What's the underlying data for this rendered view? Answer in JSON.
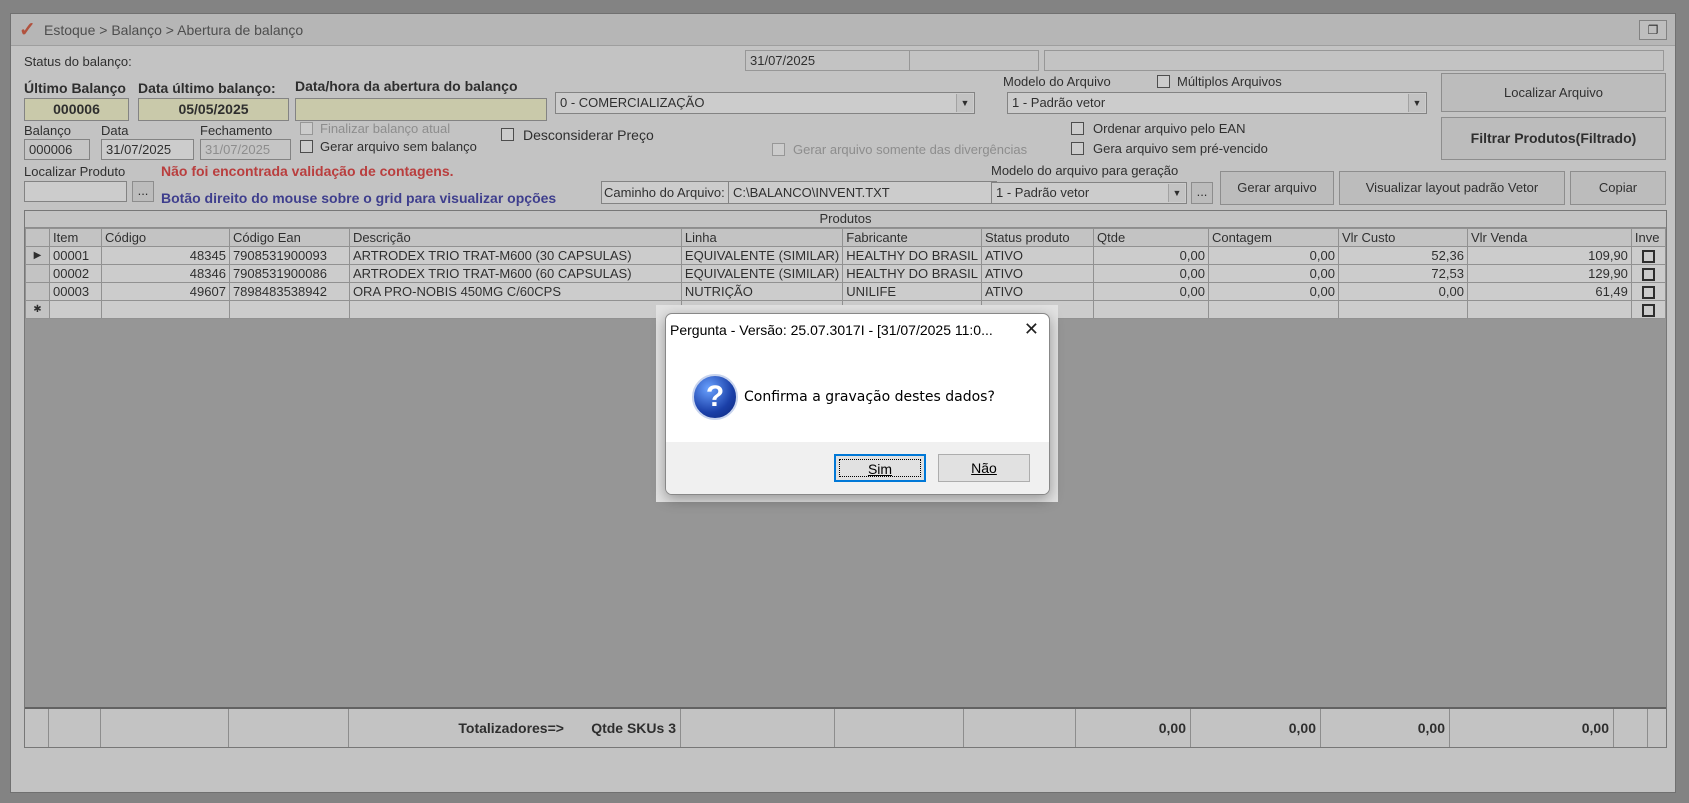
{
  "window": {
    "title": "Estoque > Balanço > Abertura de balanço",
    "logo_glyph": "✓",
    "restore_glyph": "❐"
  },
  "status": {
    "label": "Status do balanço:",
    "date": "31/07/2025"
  },
  "header": {
    "ultimo_balanco_label": "Último Balanço",
    "ultimo_balanco_value": "000006",
    "data_ultimo_label": "Data último balanço:",
    "data_ultimo_value": "05/05/2025",
    "abertura_label": "Data/hora da abertura do balanço",
    "abertura_value": "",
    "comercializacao_value": "0 - COMERCIALIZAÇÃO",
    "modelo_arquivo_label": "Modelo do Arquivo",
    "modelo_arquivo_value": "1 - Padrão vetor",
    "multiplos_label": "Múltiplos Arquivos",
    "localizar_arquivo_btn": "Localizar Arquivo"
  },
  "row2": {
    "balanco_label": "Balanço",
    "balanco_value": "000006",
    "data_label": "Data",
    "data_value": "31/07/2025",
    "fechamento_label": "Fechamento",
    "fechamento_value": "31/07/2025",
    "finalizar_label": "Finalizar balanço atual",
    "gerar_sem_label": "Gerar arquivo sem balanço",
    "desconsiderar_label": "Desconsiderar Preço",
    "gerar_div_label": "Gerar arquivo somente das divergências",
    "ordenar_label": "Ordenar arquivo pelo EAN",
    "gera_prevenc_label": "Gera arquivo sem pré-vencido",
    "filtrar_btn": "Filtrar Produtos(Filtrado)"
  },
  "row3": {
    "localizar_label": "Localizar Produto",
    "localizar_value": "",
    "ellipsis": "...",
    "aviso_red": "Não foi encontrada validação de contagens.",
    "aviso_blue": "Botão direito do mouse sobre o grid para visualizar opções",
    "caminho_label": "Caminho do Arquivo:",
    "caminho_value": "C:\\BALANCO\\INVENT.TXT",
    "modelo_geracao_label": "Modelo do arquivo para geração",
    "modelo_geracao_value": "1 - Padrão vetor",
    "gerar_btn": "Gerar arquivo",
    "visualizar_btn": "Visualizar layout padrão Vetor",
    "copiar_btn": "Copiar"
  },
  "grid": {
    "caption": "Produtos",
    "columns": [
      "Item",
      "Código",
      "Código Ean",
      "Descrição",
      "Linha",
      "Fabricante",
      "Status produto",
      "Qtde",
      "Contagem",
      "Vlr Custo",
      "Vlr Venda",
      "Inve"
    ],
    "rows": [
      [
        "00001",
        "48345",
        "7908531900093",
        "ARTRODEX TRIO TRAT-M600 (30 CAPSULAS)",
        "EQUIVALENTE (SIMILAR)",
        "HEALTHY DO BRASIL",
        "ATIVO",
        "0,00",
        "0,00",
        "52,36",
        "109,90"
      ],
      [
        "00002",
        "48346",
        "7908531900086",
        "ARTRODEX TRIO TRAT-M600 (60 CAPSULAS)",
        "EQUIVALENTE (SIMILAR)",
        "HEALTHY DO BRASIL",
        "ATIVO",
        "0,00",
        "0,00",
        "72,53",
        "129,90"
      ],
      [
        "00003",
        "49607",
        "7898483538942",
        "ORA PRO-NOBIS 450MG C/60CPS",
        "NUTRIÇÃO",
        "UNILIFE",
        "ATIVO",
        "0,00",
        "0,00",
        "0,00",
        "61,49"
      ]
    ],
    "current_row_glyph": "▶",
    "new_row_glyph": "✱"
  },
  "totals": {
    "label": "Totalizadores=>",
    "skus": "Qtde SKUs 3",
    "qtde": "0,00",
    "contagem": "0,00",
    "custo": "0,00",
    "venda": "0,00"
  },
  "dialog": {
    "title": "Pergunta - Versão: 25.07.3017I - [31/07/2025 11:0...",
    "close_glyph": "✕",
    "icon_glyph": "?",
    "message": "Confirma a gravação destes dados?",
    "yes": "Sim",
    "no": "Não"
  }
}
